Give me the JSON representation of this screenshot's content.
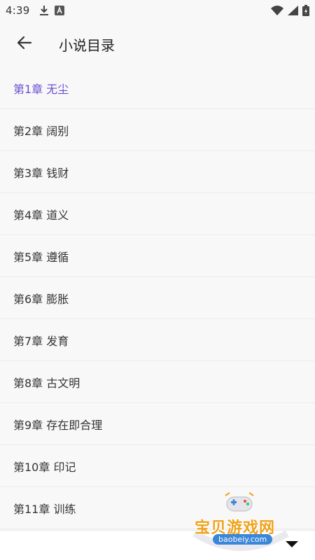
{
  "status_bar": {
    "time": "4:39",
    "icons": [
      "download-icon",
      "app-notification-icon",
      "wifi-icon",
      "signal-icon",
      "battery-icon"
    ]
  },
  "toolbar": {
    "back_icon": "arrow-left-icon",
    "title": "小说目录"
  },
  "colors": {
    "accent": "#6a4fcf",
    "text": "#333333",
    "background": "#f8f8f9"
  },
  "chapters": [
    {
      "label": "第1章 无尘",
      "active": true
    },
    {
      "label": "第2章 阔别"
    },
    {
      "label": "第3章 钱财"
    },
    {
      "label": "第4章 道义"
    },
    {
      "label": "第5章 遵循"
    },
    {
      "label": "第6章 膨胀"
    },
    {
      "label": "第7章 发育"
    },
    {
      "label": "第8章 古文明"
    },
    {
      "label": "第9章 存在即合理"
    },
    {
      "label": "第10章 印记"
    },
    {
      "label": "第11章 训练"
    }
  ],
  "watermark": {
    "name": "宝贝游戏网",
    "url": "baobeiy.com"
  },
  "bottom_bar": {
    "dropdown_icon": "caret-down-icon"
  }
}
